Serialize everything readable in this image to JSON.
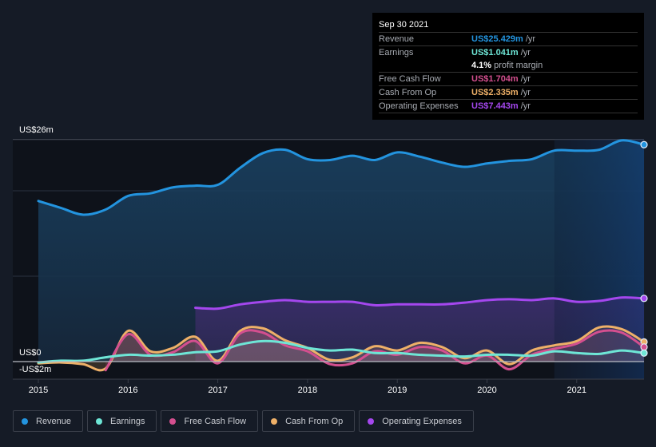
{
  "tooltip": {
    "date": "Sep 30 2021",
    "rows": [
      {
        "label": "Revenue",
        "value": "US$25.429m",
        "unit": "/yr",
        "color": "#2394df"
      },
      {
        "label": "Earnings",
        "value": "US$1.041m",
        "unit": "/yr",
        "color": "#6ee6d6"
      },
      {
        "label": "",
        "value": "4.1%",
        "unit": "profit margin",
        "color": "#ffffff"
      },
      {
        "label": "Free Cash Flow",
        "value": "US$1.704m",
        "unit": "/yr",
        "color": "#d44f8f"
      },
      {
        "label": "Cash From Op",
        "value": "US$2.335m",
        "unit": "/yr",
        "color": "#eeb068"
      },
      {
        "label": "Operating Expenses",
        "value": "US$7.443m",
        "unit": "/yr",
        "color": "#a447ee"
      }
    ]
  },
  "legend": [
    {
      "label": "Revenue",
      "color": "#2394df"
    },
    {
      "label": "Earnings",
      "color": "#6ee6d6"
    },
    {
      "label": "Free Cash Flow",
      "color": "#d44f8f"
    },
    {
      "label": "Cash From Op",
      "color": "#eeb068"
    },
    {
      "label": "Operating Expenses",
      "color": "#a447ee"
    }
  ],
  "chart_data": {
    "type": "area",
    "title": "",
    "xlabel": "",
    "ylabel": "",
    "y_top_label": "US$26m",
    "y_zero_label": "US$0",
    "y_bottom_label": "-US$2m",
    "ylim": [
      -2,
      26
    ],
    "xlim": [
      2014.7,
      2021.75
    ],
    "x_ticks": [
      "2015",
      "2016",
      "2017",
      "2018",
      "2019",
      "2020",
      "2021"
    ],
    "highlight_from": 2020.75,
    "grid": true,
    "series": [
      {
        "name": "Revenue",
        "color": "#2394df",
        "x": [
          2015.0,
          2015.25,
          2015.5,
          2015.75,
          2016.0,
          2016.25,
          2016.5,
          2016.75,
          2017.0,
          2017.25,
          2017.5,
          2017.75,
          2018.0,
          2018.25,
          2018.5,
          2018.75,
          2019.0,
          2019.25,
          2019.5,
          2019.75,
          2020.0,
          2020.25,
          2020.5,
          2020.75,
          2021.0,
          2021.25,
          2021.5,
          2021.75
        ],
        "values": [
          18.8,
          18.0,
          17.2,
          17.8,
          19.4,
          19.7,
          20.4,
          20.6,
          20.7,
          22.7,
          24.4,
          24.8,
          23.7,
          23.6,
          24.1,
          23.6,
          24.5,
          24.0,
          23.3,
          22.8,
          23.2,
          23.5,
          23.7,
          24.7,
          24.7,
          24.8,
          25.9,
          25.4
        ]
      },
      {
        "name": "Operating Expenses",
        "color": "#a447ee",
        "x": [
          2016.75,
          2017.0,
          2017.25,
          2017.5,
          2017.75,
          2018.0,
          2018.25,
          2018.5,
          2018.75,
          2019.0,
          2019.25,
          2019.5,
          2019.75,
          2020.0,
          2020.25,
          2020.5,
          2020.75,
          2021.0,
          2021.25,
          2021.5,
          2021.75
        ],
        "values": [
          6.3,
          6.2,
          6.7,
          7.0,
          7.2,
          7.0,
          7.0,
          7.0,
          6.6,
          6.7,
          6.7,
          6.7,
          6.9,
          7.2,
          7.3,
          7.2,
          7.4,
          7.0,
          7.1,
          7.5,
          7.4
        ]
      },
      {
        "name": "Cash From Op",
        "color": "#eeb068",
        "x": [
          2015.0,
          2015.25,
          2015.5,
          2015.75,
          2016.0,
          2016.25,
          2016.5,
          2016.75,
          2017.0,
          2017.25,
          2017.5,
          2017.75,
          2018.0,
          2018.25,
          2018.5,
          2018.75,
          2019.0,
          2019.25,
          2019.5,
          2019.75,
          2020.0,
          2020.25,
          2020.5,
          2020.75,
          2021.0,
          2021.25,
          2021.5,
          2021.75
        ],
        "values": [
          -0.2,
          -0.1,
          -0.3,
          -0.8,
          3.6,
          1.2,
          1.6,
          2.9,
          0.1,
          3.6,
          3.9,
          2.5,
          1.6,
          0.2,
          0.5,
          1.8,
          1.3,
          2.2,
          1.7,
          0.4,
          1.3,
          -0.3,
          1.3,
          1.9,
          2.4,
          4.0,
          3.8,
          2.3
        ]
      },
      {
        "name": "Free Cash Flow",
        "color": "#d44f8f",
        "x": [
          2015.75,
          2016.0,
          2016.25,
          2016.5,
          2016.75,
          2017.0,
          2017.25,
          2017.5,
          2017.75,
          2018.0,
          2018.25,
          2018.5,
          2018.75,
          2019.0,
          2019.25,
          2019.5,
          2019.75,
          2020.0,
          2020.25,
          2020.5,
          2020.75,
          2021.0,
          2021.25,
          2021.5,
          2021.75
        ],
        "values": [
          -1.0,
          3.2,
          0.8,
          1.1,
          2.4,
          -0.2,
          3.3,
          3.4,
          1.9,
          1.2,
          -0.3,
          -0.2,
          1.2,
          0.8,
          1.7,
          1.3,
          -0.2,
          0.7,
          -0.9,
          0.8,
          1.5,
          2.1,
          3.5,
          3.4,
          1.7
        ]
      },
      {
        "name": "Earnings",
        "color": "#6ee6d6",
        "x": [
          2015.0,
          2015.25,
          2015.5,
          2015.75,
          2016.0,
          2016.25,
          2016.5,
          2016.75,
          2017.0,
          2017.25,
          2017.5,
          2017.75,
          2018.0,
          2018.25,
          2018.5,
          2018.75,
          2019.0,
          2019.25,
          2019.5,
          2019.75,
          2020.0,
          2020.25,
          2020.5,
          2020.75,
          2021.0,
          2021.25,
          2021.5,
          2021.75
        ],
        "values": [
          -0.1,
          0.1,
          0.1,
          0.5,
          0.8,
          0.7,
          0.8,
          1.1,
          1.2,
          2.0,
          2.4,
          2.2,
          1.6,
          1.3,
          1.4,
          1.0,
          1.0,
          0.8,
          0.7,
          0.6,
          0.8,
          0.8,
          0.7,
          1.2,
          1.0,
          0.9,
          1.3,
          1.0
        ]
      }
    ]
  }
}
